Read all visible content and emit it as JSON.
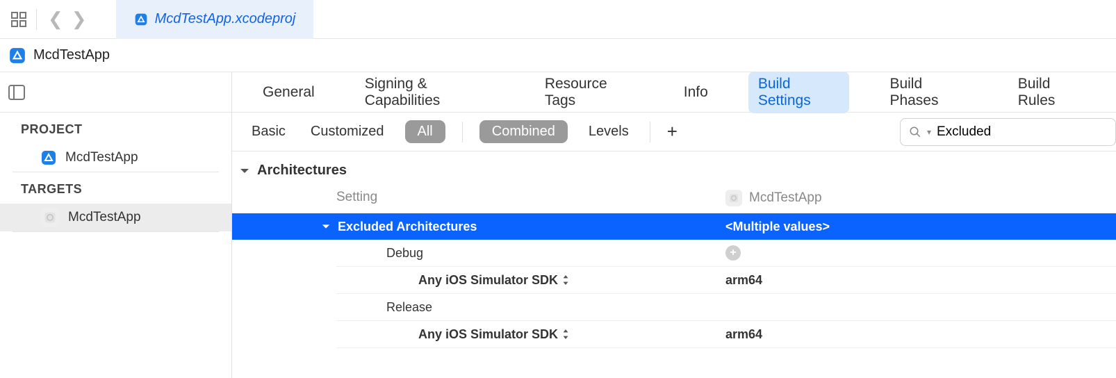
{
  "top": {
    "tab_title": "McdTestApp.xcodeproj"
  },
  "breadcrumb": {
    "project_name": "McdTestApp"
  },
  "sidebar": {
    "project_label": "PROJECT",
    "project_item": "McdTestApp",
    "targets_label": "TARGETS",
    "target_item": "McdTestApp"
  },
  "tabs": {
    "items": [
      "General",
      "Signing & Capabilities",
      "Resource Tags",
      "Info",
      "Build Settings",
      "Build Phases",
      "Build Rules"
    ],
    "active_index": 4
  },
  "filter": {
    "basic": "Basic",
    "customized": "Customized",
    "all": "All",
    "combined": "Combined",
    "levels": "Levels",
    "search_value": "Excluded"
  },
  "settings": {
    "group": "Architectures",
    "col_setting": "Setting",
    "col_target": "McdTestApp",
    "rows": {
      "excluded_arch_label": "Excluded Architectures",
      "excluded_arch_value": "<Multiple values>",
      "debug_label": "Debug",
      "debug_sdk_label": "Any iOS Simulator SDK",
      "debug_sdk_value": "arm64",
      "release_label": "Release",
      "release_sdk_label": "Any iOS Simulator SDK",
      "release_sdk_value": "arm64"
    }
  }
}
